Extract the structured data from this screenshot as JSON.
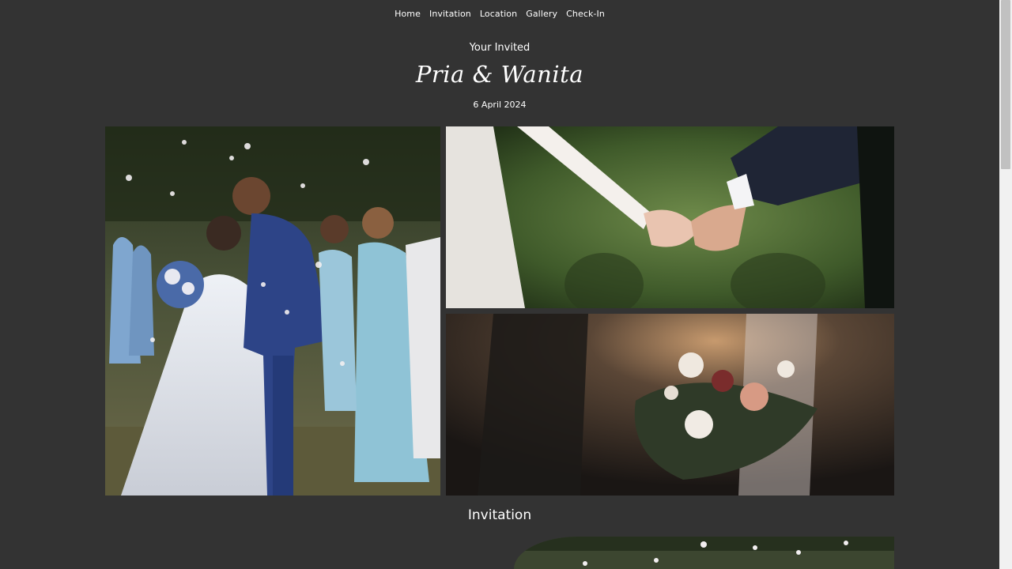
{
  "nav": {
    "items": [
      {
        "label": "Home"
      },
      {
        "label": "Invitation"
      },
      {
        "label": "Location"
      },
      {
        "label": "Gallery"
      },
      {
        "label": "Check-In"
      }
    ]
  },
  "hero": {
    "invited": "Your Invited",
    "couple": "Pria & Wanita",
    "date": "6 April 2024"
  },
  "sections": {
    "invitation_title": "Invitation"
  },
  "colors": {
    "background": "#333333",
    "text": "#ffffff"
  }
}
